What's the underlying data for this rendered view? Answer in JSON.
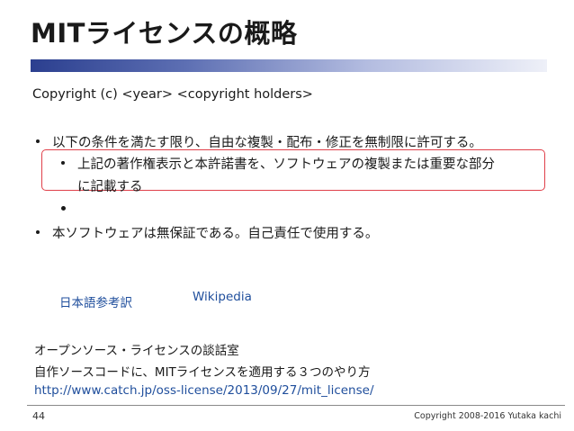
{
  "slide": {
    "title": "MITライセンスの概略",
    "copyright_line": "Copyright (c) <year> <copyright holders>",
    "bullets": {
      "b1": "以下の条件を満たす限り、自由な複製・配布・修正を無制限に許可する。",
      "b2_line1": "上記の著作権表示と本許諾書を、ソフトウェアの複製または重要な部分",
      "b2_line2": "に記載する",
      "b3": "本ソフトウェアは無保証である。自己責任で使用する。"
    },
    "links": {
      "japanese": "日本語参考訳",
      "wikipedia": "Wikipedia"
    },
    "reference": {
      "line1": "オープンソース・ライセンスの談話室",
      "line2": "自作ソースコードに、MITライセンスを適用する３つのやり方",
      "url": "http://www.catch.jp/oss-license/2013/09/27/mit_license/"
    },
    "footer": {
      "page_number": "44",
      "copyright": "Copyright 2008-2016 Yutaka kachi"
    }
  },
  "colors": {
    "title_bar_start": "#2b3f8f",
    "title_bar_end": "#eef0f8",
    "highlight_border": "#e0404a",
    "link": "#1f4e9c"
  }
}
